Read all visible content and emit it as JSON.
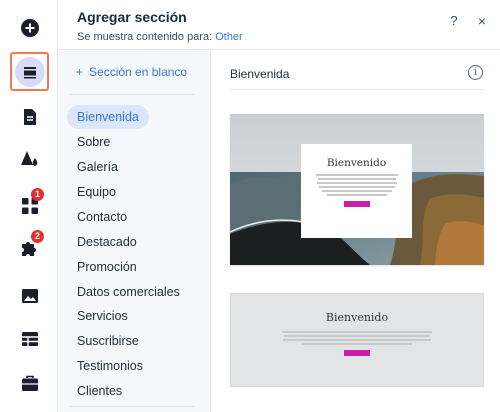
{
  "header": {
    "title": "Agregar sección",
    "subtitle_prefix": "Se muestra contenido para:",
    "subtitle_link": "Other",
    "help": "?",
    "close": "×"
  },
  "rail": {
    "items": [
      {
        "icon": "add-plus-icon"
      },
      {
        "icon": "sections-icon",
        "active": true
      },
      {
        "icon": "pages-icon"
      },
      {
        "icon": "design-theme-icon"
      },
      {
        "icon": "apps-grid-icon",
        "badge": "1"
      },
      {
        "icon": "puzzle-integrations-icon",
        "badge": "2"
      },
      {
        "icon": "media-image-icon"
      },
      {
        "icon": "cms-table-icon"
      },
      {
        "icon": "business-briefcase-icon"
      }
    ],
    "accent": "#f07a4e"
  },
  "categories": {
    "blank_label": "Sección en blanco",
    "blank_plus": "+",
    "items": [
      "Bienvenida",
      "Sobre",
      "Galería",
      "Equipo",
      "Contacto",
      "Destacado",
      "Promoción",
      "Datos comerciales",
      "Servicios",
      "Suscribirse",
      "Testimonios",
      "Clientes"
    ],
    "active": "Bienvenida"
  },
  "preview": {
    "title": "Bienvenida",
    "info": "i",
    "cards": [
      {
        "heading": "Bienvenido",
        "button_color": "#cc1da6"
      },
      {
        "heading": "Bienvenido",
        "button_color": "#cc1da6"
      }
    ]
  },
  "colors": {
    "link": "#3978d2",
    "active_bg": "#d9e6fb",
    "badge": "#e62e2e"
  }
}
